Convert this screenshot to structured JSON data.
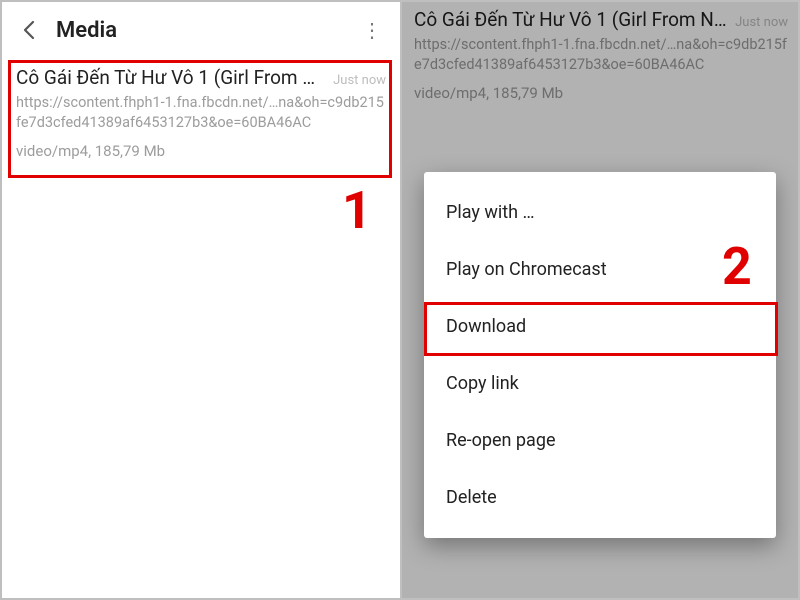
{
  "header": {
    "title": "Media"
  },
  "media_item": {
    "title": "Cô Gái Đến Từ Hư Vô 1 (Girl From N…",
    "timestamp": "Just now",
    "url": "https://scontent.fhph1-1.fna.fbcdn.net/…na&oh=c9db215fe7d3cfed41389af6453127b3&oe=60BA46AC",
    "meta": "video/mp4, 185,79 Mb"
  },
  "menu": {
    "options": [
      "Play with …",
      "Play on Chromecast",
      "Download",
      "Copy link",
      "Re-open page",
      "Delete"
    ]
  },
  "callouts": {
    "step1": "1",
    "step2": "2"
  },
  "icons": {
    "back": "←",
    "overflow": "⋮"
  }
}
